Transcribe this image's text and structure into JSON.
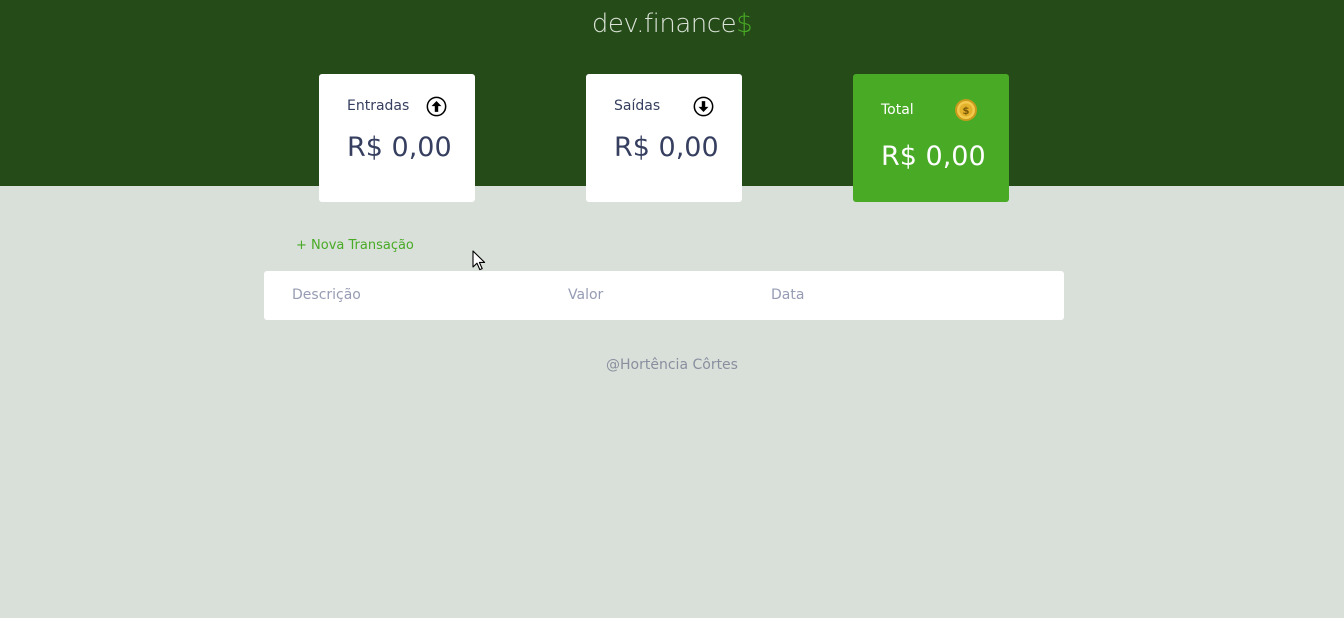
{
  "header": {
    "logo_text": "dev.finance",
    "logo_symbol": "$",
    "background_color": "#254b18",
    "accent_color": "#49aa26"
  },
  "cards": {
    "income": {
      "label": "Entradas",
      "amount": "R$ 0,00",
      "icon": "arrow-up-circle-icon"
    },
    "expense": {
      "label": "Saídas",
      "amount": "R$ 0,00",
      "icon": "arrow-down-circle-icon"
    },
    "total": {
      "label": "Total",
      "amount": "R$ 0,00",
      "icon": "dollar-coin-icon",
      "background_color": "#49aa26"
    }
  },
  "actions": {
    "new_transaction_label": "+ Nova Transação"
  },
  "table": {
    "columns": [
      "Descrição",
      "Valor",
      "Data"
    ]
  },
  "footer": {
    "credit": "@Hortência Côrtes"
  }
}
